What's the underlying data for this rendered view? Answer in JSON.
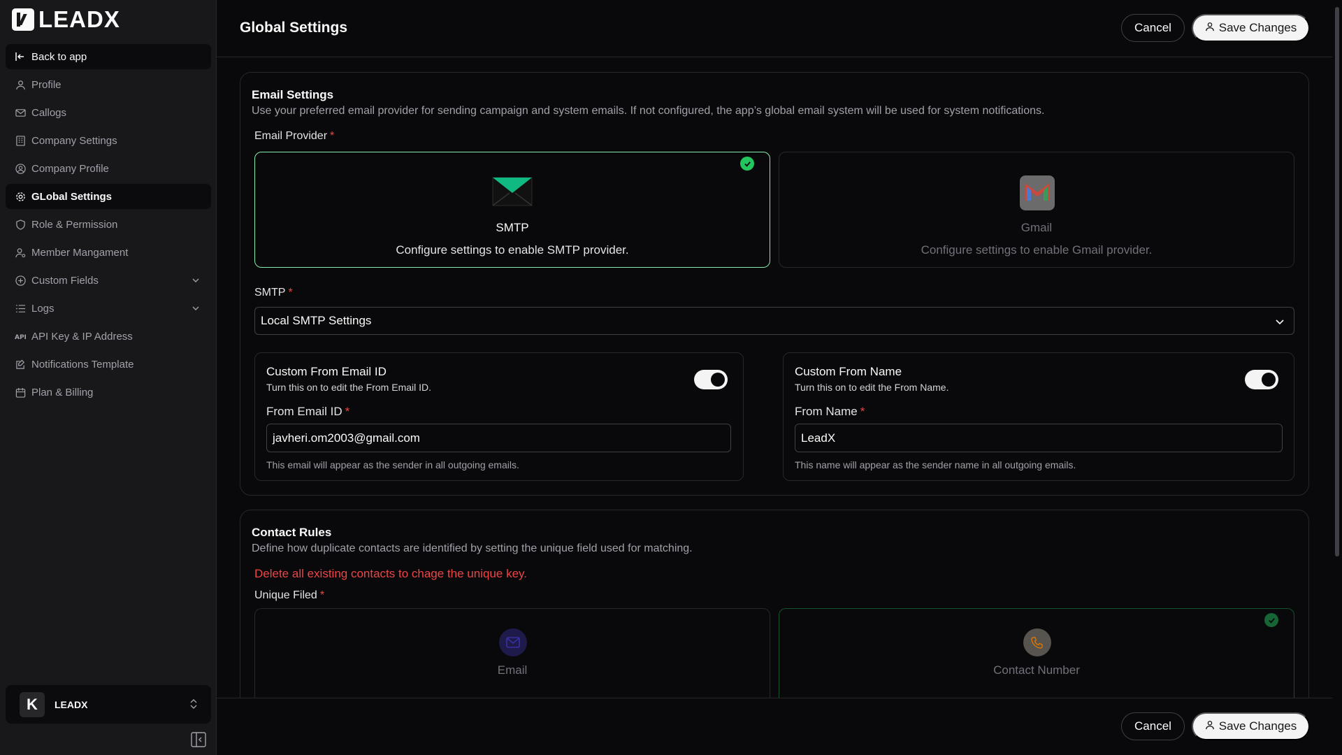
{
  "app": {
    "logo_text": "LEADX"
  },
  "sidebar": {
    "back_label": "Back to app",
    "items": [
      {
        "label": "Profile",
        "icon": "user-icon"
      },
      {
        "label": "Callogs",
        "icon": "mail-icon"
      },
      {
        "label": "Company Settings",
        "icon": "building-icon"
      },
      {
        "label": "Company Profile",
        "icon": "user-circle-icon"
      },
      {
        "label": "GLobal Settings",
        "icon": "gear-icon"
      },
      {
        "label": "Role & Permission",
        "icon": "shield-icon"
      },
      {
        "label": "Member Mangament",
        "icon": "user-gear-icon"
      },
      {
        "label": "Custom Fields",
        "icon": "plus-circle-icon"
      },
      {
        "label": "Logs",
        "icon": "list-icon"
      },
      {
        "label": "API Key & IP Address",
        "icon": "api-icon"
      },
      {
        "label": "Notifications Template",
        "icon": "edit-icon"
      },
      {
        "label": "Plan & Billing",
        "icon": "calendar-icon"
      }
    ],
    "workspace": {
      "logo": "K",
      "name": "LEADX"
    }
  },
  "header": {
    "title": "Global Settings",
    "cancel_label": "Cancel",
    "save_label": "Save Changes"
  },
  "email_settings": {
    "title": "Email Settings",
    "description": "Use your preferred email provider for sending campaign and system emails. If not configured, the app’s global email system will be used for system notifications.",
    "provider_label": "Email Provider",
    "required_mark": "*",
    "providers": [
      {
        "name": "SMTP",
        "description": "Configure settings to enable SMTP provider.",
        "selected": true
      },
      {
        "name": "Gmail",
        "description": "Configure settings to enable Gmail provider.",
        "selected": false
      }
    ],
    "smtp_label": "SMTP",
    "smtp_value": "Local SMTP Settings",
    "from_email": {
      "title": "Custom From Email ID",
      "description": "Turn this on to edit the From Email ID.",
      "field_label": "From Email ID",
      "value": "javheri.om2003@gmail.com",
      "hint": "This email will appear as the sender in all outgoing emails.",
      "enabled": true
    },
    "from_name": {
      "title": "Custom From Name",
      "description": "Turn this on to edit the From Name.",
      "field_label": "From Name",
      "value": "LeadX",
      "hint": "This name will appear as the sender name in all outgoing emails.",
      "enabled": true
    }
  },
  "contact_rules": {
    "title": "Contact Rules",
    "description": "Define how duplicate contacts are identified by setting the unique field used for matching.",
    "warning": "Delete all existing contacts to chage the unique key.",
    "unique_label": "Unique Filed",
    "options": [
      {
        "name": "Email",
        "selected": false
      },
      {
        "name": "Contact Number",
        "selected": true
      }
    ]
  },
  "colors": {
    "accent_success": "#22c55e",
    "danger": "#ef4444",
    "background": "#09090b",
    "sidebar": "#18181b"
  }
}
